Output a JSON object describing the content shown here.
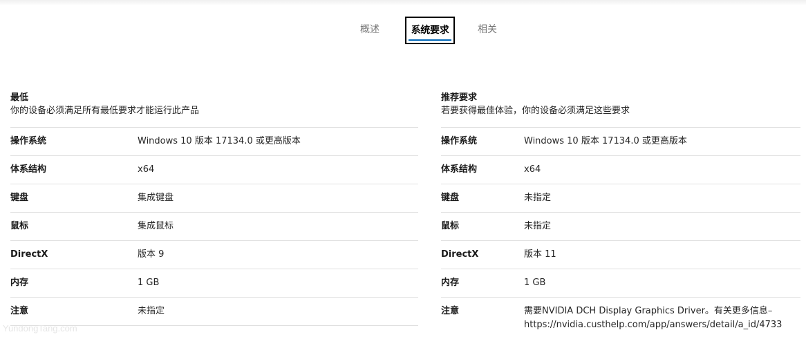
{
  "tabs": [
    {
      "label": "概述"
    },
    {
      "label": "系统要求"
    },
    {
      "label": "相关"
    }
  ],
  "minimum": {
    "title": "最低",
    "subtitle": "你的设备必须满足所有最低要求才能运行此产品",
    "rows": [
      {
        "key": "操作系统",
        "value": "Windows 10 版本 17134.0 或更高版本"
      },
      {
        "key": "体系结构",
        "value": "x64"
      },
      {
        "key": "键盘",
        "value": "集成键盘"
      },
      {
        "key": "鼠标",
        "value": "集成鼠标"
      },
      {
        "key": "DirectX",
        "value": "版本 9"
      },
      {
        "key": "内存",
        "value": "1 GB"
      },
      {
        "key": "注意",
        "value": "未指定"
      }
    ]
  },
  "recommended": {
    "title": "推荐要求",
    "subtitle": "若要获得最佳体验，你的设备必须满足这些要求",
    "rows": [
      {
        "key": "操作系统",
        "value": "Windows 10 版本 17134.0 或更高版本"
      },
      {
        "key": "体系结构",
        "value": "x64"
      },
      {
        "key": "键盘",
        "value": "未指定"
      },
      {
        "key": "鼠标",
        "value": "未指定"
      },
      {
        "key": "DirectX",
        "value": "版本 11"
      },
      {
        "key": "内存",
        "value": "1 GB"
      },
      {
        "key": "注意",
        "value": "需要NVIDIA DCH Display Graphics Driver。有关更多信息– https://nvidia.custhelp.com/app/answers/detail/a_id/4733"
      }
    ]
  },
  "watermark": "YundongTang.com",
  "colors": {
    "accent": "#0067b8",
    "focus_border": "#000000",
    "divider": "#e0e0e0"
  }
}
